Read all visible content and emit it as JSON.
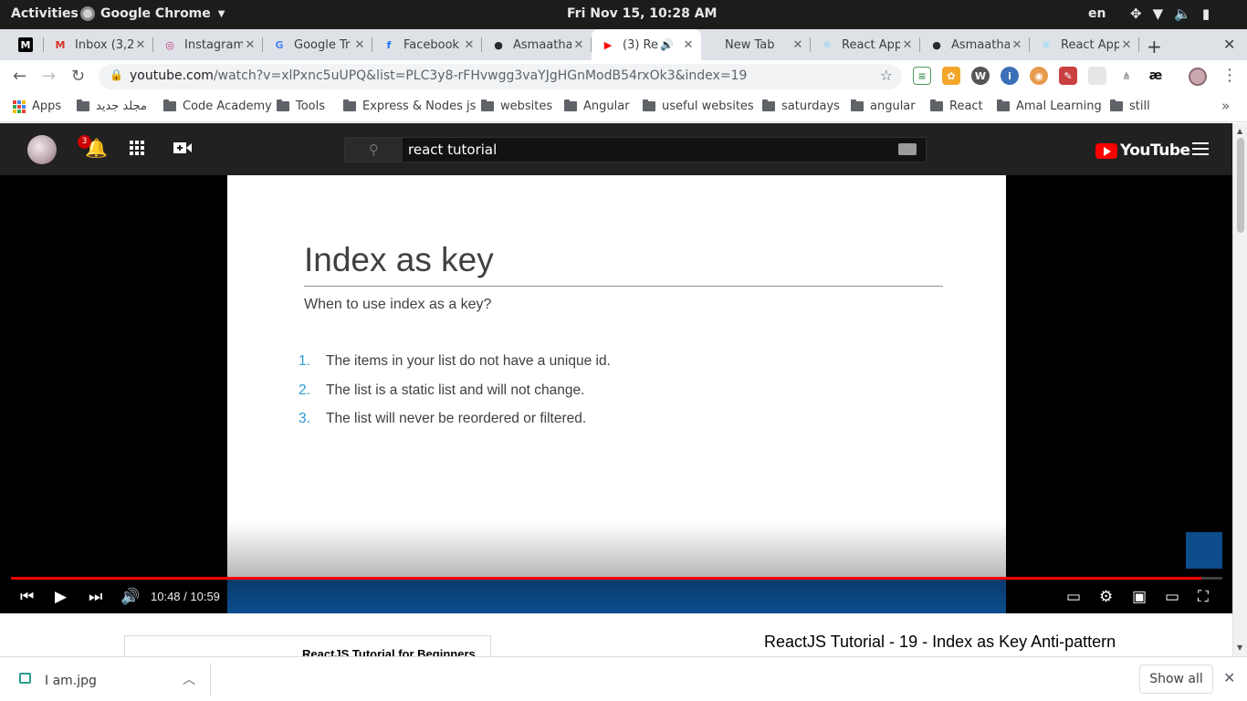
{
  "os": {
    "activities": "Activities",
    "app_name": "Google Chrome",
    "clock": "Fri Nov 15, 10:28 AM",
    "lang": "en",
    "tray_icons": [
      "accessibility-icon",
      "wifi-icon",
      "volume-icon",
      "battery-icon"
    ]
  },
  "tabs": [
    {
      "title": "",
      "favicon": "medium-icon",
      "color": "#000000",
      "glyph": "M"
    },
    {
      "title": "Inbox (3,2",
      "favicon": "gmail-icon",
      "color": "#d93025",
      "glyph": "M"
    },
    {
      "title": "Instagram",
      "favicon": "instagram-icon",
      "color": "#c13584",
      "glyph": "◎"
    },
    {
      "title": "Google Tr",
      "favicon": "google-translate-icon",
      "color": "#4285f4",
      "glyph": "G"
    },
    {
      "title": "Facebook",
      "favicon": "facebook-icon",
      "color": "#1877f2",
      "glyph": "f"
    },
    {
      "title": "Asmaatha",
      "favicon": "github-icon",
      "color": "#24292e",
      "glyph": "●"
    },
    {
      "title": "(3) Re",
      "favicon": "youtube-icon",
      "color": "#ff0000",
      "glyph": "▶",
      "active": true
    },
    {
      "title": "New Tab",
      "favicon": "",
      "color": "",
      "glyph": ""
    },
    {
      "title": "React App",
      "favicon": "react-icon",
      "color": "#61dafb",
      "glyph": "⚛"
    },
    {
      "title": "Asmaatha",
      "favicon": "github-icon",
      "color": "#24292e",
      "glyph": "●"
    },
    {
      "title": "React App",
      "favicon": "react-icon",
      "color": "#61dafb",
      "glyph": "⚛"
    }
  ],
  "omnibox": {
    "host": "youtube.com",
    "path": "/watch?v=xlPxnc5uUPQ&list=PLC3y8-rFHvwgg3vaYJgHGnModB54rxOk3&index=19"
  },
  "bookmarks": {
    "apps": "Apps",
    "folders": [
      "مجلد جديد",
      "Code Academy",
      "Tools",
      "Express & Nodes js",
      "websites",
      "Angular",
      "useful websites",
      "saturdays",
      "angular",
      "React",
      "Amal Learning",
      "still"
    ]
  },
  "youtube": {
    "notification_count": "3",
    "search_query": "react tutorial",
    "logo_text": "YouTube"
  },
  "slide": {
    "title": "Index as key",
    "subtitle": "When to use index as a key?",
    "items": [
      {
        "num": "1.",
        "text": "The items in your list do not have a unique id."
      },
      {
        "num": "2.",
        "text": "The list is a static list and will not change."
      },
      {
        "num": "3.",
        "text": "The list will never be reordered or filtered."
      }
    ]
  },
  "player": {
    "time": "10:48 / 10:59",
    "progress_fraction": 0.983
  },
  "page": {
    "playlist_title": "ReactJS Tutorial for Beginners",
    "video_title": "ReactJS Tutorial - 19 - Index as Key Anti-pattern"
  },
  "downloads": {
    "file_name": "I am.jpg",
    "show_all": "Show all"
  }
}
